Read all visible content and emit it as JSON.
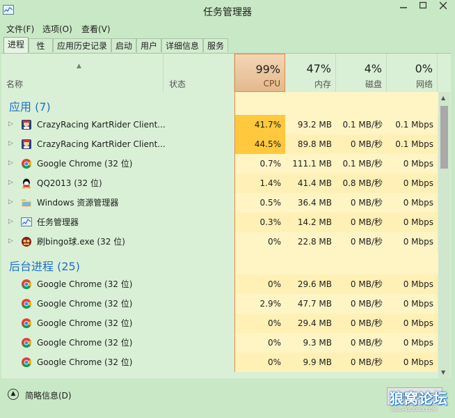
{
  "window": {
    "title": "任务管理器"
  },
  "menu": [
    "文件(F)",
    "选项(O)",
    "查看(V)"
  ],
  "tabs": [
    "进程",
    "性能",
    "应用历史记录",
    "启动",
    "用户",
    "详细信息",
    "服务"
  ],
  "active_tab": "进程",
  "columns": {
    "name": "名称",
    "status": "状态",
    "cpu": {
      "percent": "99%",
      "label": "CPU"
    },
    "memory": {
      "percent": "47%",
      "label": "内存"
    },
    "disk": {
      "percent": "4%",
      "label": "磁盘"
    },
    "network": {
      "percent": "0%",
      "label": "网络"
    }
  },
  "groups": [
    {
      "title": "应用 (7)",
      "rows": [
        {
          "name": "CrazyRacing KartRider Client...",
          "cpu": "41.7%",
          "memory": "93.2 MB",
          "disk": "0.1 MB/秒",
          "network": "0.1 Mbps",
          "icon": "kartrider-icon",
          "expandable": true,
          "highlight": "high"
        },
        {
          "name": "CrazyRacing KartRider Client...",
          "cpu": "44.5%",
          "memory": "89.8 MB",
          "disk": "0 MB/秒",
          "network": "0.1 Mbps",
          "icon": "kartrider-icon",
          "expandable": true,
          "highlight": "high"
        },
        {
          "name": "Google Chrome (32 位)",
          "cpu": "0.7%",
          "memory": "111.1 MB",
          "disk": "0.1 MB/秒",
          "network": "0 Mbps",
          "icon": "chrome-icon",
          "expandable": true,
          "highlight": "low"
        },
        {
          "name": "QQ2013 (32 位)",
          "cpu": "1.4%",
          "memory": "41.4 MB",
          "disk": "0.8 MB/秒",
          "network": "0 Mbps",
          "icon": "qq-icon",
          "expandable": true,
          "highlight": "low"
        },
        {
          "name": "Windows 资源管理器",
          "cpu": "0.5%",
          "memory": "36.4 MB",
          "disk": "0 MB/秒",
          "network": "0 Mbps",
          "icon": "explorer-folder-icon",
          "expandable": true,
          "highlight": "low"
        },
        {
          "name": "任务管理器",
          "cpu": "0.3%",
          "memory": "14.2 MB",
          "disk": "0 MB/秒",
          "network": "0 Mbps",
          "icon": "task-manager-icon",
          "expandable": true,
          "highlight": "low"
        },
        {
          "name": "刷bingo球.exe (32 位)",
          "cpu": "0%",
          "memory": "22.8 MB",
          "disk": "0 MB/秒",
          "network": "0 Mbps",
          "icon": "bingo-app-icon",
          "expandable": true,
          "highlight": "low"
        }
      ]
    },
    {
      "title": "后台进程 (25)",
      "rows": [
        {
          "name": "Google Chrome (32 位)",
          "cpu": "0%",
          "memory": "29.6 MB",
          "disk": "0 MB/秒",
          "network": "0 Mbps",
          "icon": "chrome-icon",
          "expandable": false,
          "highlight": "low"
        },
        {
          "name": "Google Chrome (32 位)",
          "cpu": "2.9%",
          "memory": "47.7 MB",
          "disk": "0 MB/秒",
          "network": "0 Mbps",
          "icon": "chrome-icon",
          "expandable": false,
          "highlight": "low"
        },
        {
          "name": "Google Chrome (32 位)",
          "cpu": "0%",
          "memory": "29.4 MB",
          "disk": "0 MB/秒",
          "network": "0 Mbps",
          "icon": "chrome-icon",
          "expandable": false,
          "highlight": "low"
        },
        {
          "name": "Google Chrome (32 位)",
          "cpu": "0%",
          "memory": "9.3 MB",
          "disk": "0 MB/秒",
          "network": "0 Mbps",
          "icon": "chrome-icon",
          "expandable": false,
          "highlight": "low"
        },
        {
          "name": "Google Chrome (32 位)",
          "cpu": "0%",
          "memory": "9.9 MB",
          "disk": "0 MB/秒",
          "network": "0 Mbps",
          "icon": "chrome-icon",
          "expandable": false,
          "highlight": "low"
        }
      ]
    }
  ],
  "footer": {
    "fewer_details": "简略信息(D)",
    "end_task": "结束任务(E)"
  },
  "watermark": {
    "text": "狼窝论坛",
    "url": "BBS.HOUDAO.COM"
  },
  "colors": {
    "accent": "#1e6fc9",
    "background": "#c9e8c5",
    "cpu_high": "#ffc83d",
    "cell_low": "#fff4c4",
    "cpu_header": "#e3b98d"
  }
}
